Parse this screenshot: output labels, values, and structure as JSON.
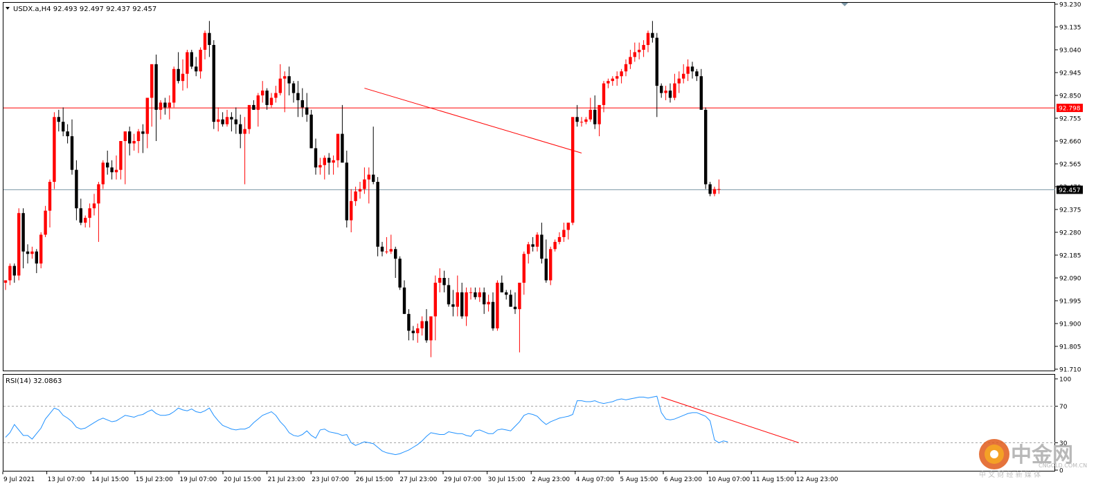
{
  "chart_data": [
    {
      "type": "candlestick",
      "symbol_header": "USDX.a,H4  92.493 92.497 92.437 92.457",
      "ylim": [
        91.71,
        93.23
      ],
      "y_ticks": [
        "93.230",
        "93.135",
        "93.040",
        "92.945",
        "92.850",
        "92.755",
        "92.660",
        "92.565",
        "92.470",
        "92.375",
        "92.280",
        "92.185",
        "92.090",
        "91.995",
        "91.900",
        "91.805",
        "91.710"
      ],
      "price_labels": [
        {
          "value": 92.798,
          "text": "92.798",
          "color": "#ff0000"
        },
        {
          "value": 92.457,
          "text": "92.457",
          "color": "#000000"
        }
      ],
      "x_tick_labels": [
        "9 Jul 2021",
        "13 Jul 07:00",
        "14 Jul 15:00",
        "15 Jul 23:00",
        "19 Jul 07:00",
        "20 Jul 15:00",
        "21 Jul 23:00",
        "23 Jul 07:00",
        "26 Jul 15:00",
        "27 Jul 23:00",
        "29 Jul 07:00",
        "30 Jul 15:00",
        "2 Aug 23:00",
        "4 Aug 07:00",
        "5 Aug 15:00",
        "6 Aug 23:00",
        "10 Aug 07:00",
        "11 Aug 15:00",
        "12 Aug 23:00"
      ],
      "horizontal_lines": [
        {
          "value": 92.798,
          "color": "#ff0000"
        },
        {
          "value": 92.457,
          "color": "#7f9aa8"
        }
      ],
      "trendline": {
        "from": [
          81,
          92.88
        ],
        "to": [
          130,
          92.61
        ],
        "color": "#ff0000"
      },
      "candles": [
        [
          92.07,
          92.08,
          92.04,
          92.08
        ],
        [
          92.08,
          92.15,
          92.06,
          92.14
        ],
        [
          92.14,
          92.15,
          92.07,
          92.1
        ],
        [
          92.1,
          92.38,
          92.08,
          92.36
        ],
        [
          92.36,
          92.38,
          92.13,
          92.2
        ],
        [
          92.2,
          92.23,
          92.15,
          92.19
        ],
        [
          92.19,
          92.22,
          92.17,
          92.2
        ],
        [
          92.2,
          92.21,
          92.11,
          92.15
        ],
        [
          92.15,
          92.28,
          92.13,
          92.27
        ],
        [
          92.27,
          92.39,
          92.26,
          92.37
        ],
        [
          92.37,
          92.5,
          92.3,
          92.49
        ],
        [
          92.49,
          92.78,
          92.46,
          92.76
        ],
        [
          92.76,
          92.79,
          92.7,
          92.74
        ],
        [
          92.74,
          92.8,
          92.68,
          92.7
        ],
        [
          92.7,
          92.73,
          92.65,
          92.68
        ],
        [
          92.68,
          92.75,
          92.52,
          92.54
        ],
        [
          92.54,
          92.58,
          92.33,
          92.38
        ],
        [
          92.38,
          92.42,
          92.31,
          92.32
        ],
        [
          92.32,
          92.35,
          92.3,
          92.34
        ],
        [
          92.34,
          92.4,
          92.3,
          92.38
        ],
        [
          92.38,
          92.44,
          92.35,
          92.4
        ],
        [
          92.4,
          92.49,
          92.24,
          92.48
        ],
        [
          92.48,
          92.58,
          92.46,
          92.57
        ],
        [
          92.57,
          92.62,
          92.52,
          92.55
        ],
        [
          92.55,
          92.58,
          92.5,
          92.53
        ],
        [
          92.53,
          92.6,
          92.5,
          92.54
        ],
        [
          92.54,
          92.62,
          92.5,
          92.66
        ],
        [
          92.66,
          92.7,
          92.48,
          92.7
        ],
        [
          92.7,
          92.72,
          92.6,
          92.65
        ],
        [
          92.65,
          92.69,
          92.62,
          92.66
        ],
        [
          92.66,
          92.71,
          92.61,
          92.7
        ],
        [
          92.7,
          92.73,
          92.61,
          92.69
        ],
        [
          92.69,
          92.81,
          92.63,
          92.84
        ],
        [
          92.84,
          92.9,
          92.72,
          92.98
        ],
        [
          92.98,
          93.02,
          92.66,
          92.79
        ],
        [
          92.79,
          92.83,
          92.75,
          92.82
        ],
        [
          92.82,
          92.84,
          92.77,
          92.8
        ],
        [
          92.8,
          92.85,
          92.75,
          92.82
        ],
        [
          92.82,
          92.97,
          92.8,
          92.96
        ],
        [
          92.96,
          93.03,
          92.9,
          92.91
        ],
        [
          92.91,
          93.0,
          92.87,
          92.94
        ],
        [
          92.94,
          93.04,
          92.88,
          93.03
        ],
        [
          93.03,
          93.04,
          92.96,
          92.97
        ],
        [
          92.97,
          93.01,
          92.93,
          92.95
        ],
        [
          92.95,
          93.05,
          92.92,
          93.04
        ],
        [
          93.04,
          93.12,
          93.0,
          93.11
        ],
        [
          93.11,
          93.16,
          93.01,
          93.06
        ],
        [
          93.06,
          93.08,
          92.71,
          92.74
        ],
        [
          92.74,
          92.8,
          92.7,
          92.75
        ],
        [
          92.75,
          92.78,
          92.72,
          92.73
        ],
        [
          92.73,
          92.79,
          92.72,
          92.76
        ],
        [
          92.76,
          92.78,
          92.7,
          92.75
        ],
        [
          92.75,
          92.8,
          92.69,
          92.73
        ],
        [
          92.73,
          92.77,
          92.63,
          92.69
        ],
        [
          92.69,
          92.76,
          92.48,
          92.71
        ],
        [
          92.71,
          92.75,
          92.69,
          92.81
        ],
        [
          92.81,
          92.83,
          92.79,
          92.79
        ],
        [
          92.79,
          92.86,
          92.72,
          92.85
        ],
        [
          92.85,
          92.91,
          92.82,
          92.87
        ],
        [
          92.87,
          92.88,
          92.79,
          92.81
        ],
        [
          92.81,
          92.86,
          92.8,
          92.84
        ],
        [
          92.84,
          92.89,
          92.82,
          92.86
        ],
        [
          92.86,
          92.98,
          92.85,
          92.92
        ],
        [
          92.92,
          92.95,
          92.78,
          92.93
        ],
        [
          92.93,
          92.97,
          92.85,
          92.9
        ],
        [
          92.9,
          92.91,
          92.82,
          92.86
        ],
        [
          92.86,
          92.91,
          92.76,
          92.83
        ],
        [
          92.83,
          92.88,
          92.76,
          92.8
        ],
        [
          92.8,
          92.86,
          92.74,
          92.77
        ],
        [
          92.77,
          92.79,
          92.63,
          92.63
        ],
        [
          92.63,
          92.67,
          92.52,
          92.55
        ],
        [
          92.55,
          92.59,
          92.52,
          92.56
        ],
        [
          92.56,
          92.6,
          92.5,
          92.59
        ],
        [
          92.59,
          92.61,
          92.52,
          92.57
        ],
        [
          92.57,
          92.6,
          92.52,
          92.58
        ],
        [
          92.58,
          92.68,
          92.55,
          92.69
        ],
        [
          92.69,
          92.81,
          92.66,
          92.57
        ],
        [
          92.57,
          92.62,
          92.3,
          92.33
        ],
        [
          92.33,
          92.46,
          92.28,
          92.41
        ],
        [
          92.41,
          92.47,
          92.39,
          92.45
        ],
        [
          92.45,
          92.49,
          92.42,
          92.46
        ],
        [
          92.46,
          92.55,
          92.44,
          92.5
        ],
        [
          92.5,
          92.55,
          92.4,
          92.52
        ],
        [
          92.52,
          92.72,
          92.48,
          92.49
        ],
        [
          92.49,
          92.51,
          92.18,
          92.22
        ],
        [
          92.22,
          92.24,
          92.18,
          92.2
        ],
        [
          92.2,
          92.26,
          92.19,
          92.2
        ],
        [
          92.2,
          92.27,
          92.19,
          92.21
        ],
        [
          92.21,
          92.22,
          92.09,
          92.17
        ],
        [
          92.17,
          92.18,
          92.04,
          92.05
        ],
        [
          92.05,
          92.08,
          91.94,
          91.94
        ],
        [
          91.94,
          91.96,
          91.83,
          91.87
        ],
        [
          91.87,
          91.89,
          91.83,
          91.86
        ],
        [
          91.86,
          91.9,
          91.82,
          91.88
        ],
        [
          91.88,
          91.93,
          91.85,
          91.91
        ],
        [
          91.91,
          91.96,
          91.82,
          91.83
        ],
        [
          91.83,
          91.91,
          91.76,
          91.93
        ],
        [
          91.93,
          92.1,
          91.83,
          92.07
        ],
        [
          92.07,
          92.13,
          92.03,
          92.09
        ],
        [
          92.09,
          92.12,
          92.03,
          92.06
        ],
        [
          92.06,
          92.09,
          91.97,
          91.98
        ],
        [
          91.98,
          92.04,
          91.93,
          91.97
        ],
        [
          91.97,
          92.1,
          91.93,
          92.03
        ],
        [
          92.03,
          92.07,
          91.92,
          91.93
        ],
        [
          91.93,
          92.05,
          91.89,
          92.03
        ],
        [
          92.03,
          92.05,
          92.0,
          92.03
        ],
        [
          92.03,
          92.05,
          92.0,
          92.01
        ],
        [
          92.01,
          92.05,
          91.99,
          92.03
        ],
        [
          92.03,
          92.05,
          91.94,
          91.98
        ],
        [
          91.98,
          92.02,
          91.95,
          91.99
        ],
        [
          91.99,
          92.03,
          91.87,
          91.88
        ],
        [
          91.88,
          92.08,
          91.87,
          92.07
        ],
        [
          92.07,
          92.1,
          92.03,
          92.03
        ],
        [
          92.03,
          92.04,
          92.0,
          92.02
        ],
        [
          92.02,
          92.04,
          91.97,
          91.97
        ],
        [
          91.97,
          92.03,
          91.94,
          91.96
        ],
        [
          91.96,
          91.98,
          91.78,
          92.07
        ],
        [
          92.07,
          92.2,
          92.02,
          92.19
        ],
        [
          92.19,
          92.24,
          92.15,
          92.23
        ],
        [
          92.23,
          92.26,
          92.2,
          92.22
        ],
        [
          92.22,
          92.28,
          92.2,
          92.27
        ],
        [
          92.27,
          92.32,
          92.15,
          92.17
        ],
        [
          92.17,
          92.25,
          92.07,
          92.08
        ],
        [
          92.08,
          92.22,
          92.06,
          92.21
        ],
        [
          92.21,
          92.25,
          92.2,
          92.24
        ],
        [
          92.24,
          92.28,
          92.23,
          92.26
        ],
        [
          92.26,
          92.32,
          92.24,
          92.29
        ],
        [
          92.29,
          92.32,
          92.25,
          92.32
        ],
        [
          92.32,
          92.4,
          92.31,
          92.76
        ],
        [
          92.76,
          92.81,
          92.72,
          92.74
        ],
        [
          92.74,
          92.76,
          92.72,
          92.74
        ],
        [
          92.74,
          92.76,
          92.73,
          92.75
        ],
        [
          92.75,
          92.84,
          92.74,
          92.79
        ],
        [
          92.79,
          92.85,
          92.71,
          92.73
        ],
        [
          92.73,
          92.78,
          92.68,
          92.81
        ],
        [
          92.81,
          92.91,
          92.78,
          92.9
        ],
        [
          92.9,
          92.92,
          92.88,
          92.91
        ],
        [
          92.91,
          92.93,
          92.89,
          92.92
        ],
        [
          92.92,
          92.95,
          92.89,
          92.93
        ],
        [
          92.93,
          92.96,
          92.9,
          92.95
        ],
        [
          92.95,
          93.0,
          92.93,
          92.98
        ],
        [
          92.98,
          93.04,
          92.96,
          93.01
        ],
        [
          93.01,
          93.07,
          92.99,
          93.03
        ],
        [
          93.03,
          93.07,
          93.0,
          93.04
        ],
        [
          93.04,
          93.08,
          93.01,
          93.06
        ],
        [
          93.06,
          93.12,
          93.03,
          93.11
        ],
        [
          93.11,
          93.16,
          93.07,
          93.09
        ],
        [
          93.09,
          93.11,
          92.76,
          92.89
        ],
        [
          92.89,
          92.9,
          92.84,
          92.86
        ],
        [
          92.86,
          92.89,
          92.83,
          92.87
        ],
        [
          92.87,
          92.9,
          92.82,
          92.84
        ],
        [
          92.84,
          92.94,
          92.83,
          92.9
        ],
        [
          92.9,
          92.95,
          92.86,
          92.92
        ],
        [
          92.92,
          92.98,
          92.9,
          92.94
        ],
        [
          92.94,
          93.0,
          92.91,
          92.97
        ],
        [
          92.97,
          92.99,
          92.92,
          92.95
        ],
        [
          92.95,
          92.96,
          92.91,
          92.93
        ],
        [
          92.93,
          92.96,
          92.84,
          92.79
        ],
        [
          92.79,
          92.8,
          92.46,
          92.48
        ],
        [
          92.48,
          92.49,
          92.43,
          92.44
        ],
        [
          92.44,
          92.47,
          92.43,
          92.46
        ],
        [
          92.46,
          92.5,
          92.44,
          92.46
        ]
      ]
    },
    {
      "type": "line",
      "indicator_label": "RSI(14) 32.0863",
      "ylim": [
        0,
        100
      ],
      "y_ticks": [
        "100",
        "70",
        "30",
        "0"
      ],
      "levels": [
        70,
        30
      ],
      "line_color": "#1e90ff",
      "trendline": {
        "from": [
          148,
          80
        ],
        "to": [
          179,
          30
        ],
        "color": "#ff0000"
      },
      "values": [
        36,
        41,
        50,
        44,
        38,
        38,
        34,
        40,
        46,
        56,
        62,
        68,
        66,
        60,
        57,
        53,
        47,
        45,
        46,
        49,
        52,
        55,
        57,
        55,
        53,
        54,
        57,
        60,
        59,
        58,
        60,
        61,
        64,
        66,
        62,
        60,
        60,
        61,
        64,
        68,
        66,
        65,
        67,
        64,
        63,
        65,
        68,
        60,
        54,
        49,
        47,
        45,
        44,
        45,
        45,
        47,
        52,
        56,
        60,
        62,
        64,
        60,
        53,
        48,
        41,
        38,
        37,
        39,
        43,
        38,
        35,
        44,
        45,
        42,
        41,
        40,
        38,
        39,
        30,
        27,
        29,
        31,
        30,
        29,
        25,
        21,
        19,
        18,
        17,
        18,
        20,
        22,
        25,
        28,
        32,
        37,
        41,
        40,
        39,
        39,
        42,
        41,
        40,
        40,
        38,
        37,
        43,
        44,
        42,
        40,
        40,
        44,
        45,
        44,
        43,
        48,
        53,
        60,
        62,
        61,
        59,
        54,
        50,
        53,
        55,
        57,
        58,
        59,
        61,
        76,
        76,
        75,
        75,
        76,
        74,
        73,
        74,
        75,
        77,
        78,
        77,
        78,
        79,
        80,
        80,
        79,
        80,
        81,
        63,
        56,
        55,
        56,
        58,
        60,
        62,
        63,
        63,
        61,
        59,
        54,
        33,
        30,
        32,
        31
      ]
    }
  ],
  "watermark": {
    "brand": "中金网",
    "domain": "CNGOLD.COM.CN",
    "tagline": "中 文 财 经 新 媒 体"
  }
}
